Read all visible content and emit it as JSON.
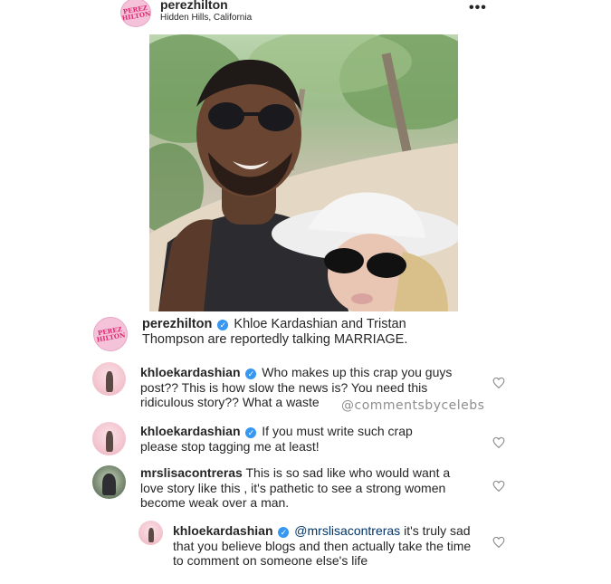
{
  "post": {
    "username": "perezhilton",
    "location": "Hidden Hills, California",
    "more_label": "•••",
    "avatar_text": "PEREZ HILTON"
  },
  "caption": {
    "username": "perezhilton",
    "text": "Khloe Kardashian and Tristan Thompson are reportedly talking MARRIAGE."
  },
  "comments": [
    {
      "username": "khloekardashian",
      "verified": true,
      "text": "Who makes up this crap you guys post?? This is how slow the news is? You need this ridiculous story?? What a waste"
    },
    {
      "username": "khloekardashian",
      "verified": true,
      "text": "If you must write such crap please stop tagging me at least!"
    },
    {
      "username": "mrslisacontreras",
      "verified": false,
      "text": "This is so sad like who would want a love story like this , it's pathetic to see a strong women become weak over a man."
    },
    {
      "username": "khloekardashian",
      "verified": true,
      "mention": "@mrslisacontreras",
      "text": "it's truly sad that you believe blogs and then actually take the time to comment on someone else's life"
    }
  ],
  "watermark": "@commentsbycelebs",
  "icons": {
    "verified": "verified-badge-icon",
    "like": "heart-outline-icon",
    "more": "ellipsis-icon"
  },
  "colors": {
    "verified": "#3897f0",
    "text": "#262626",
    "mention": "#003569",
    "brand_pink": "#e3246e"
  }
}
